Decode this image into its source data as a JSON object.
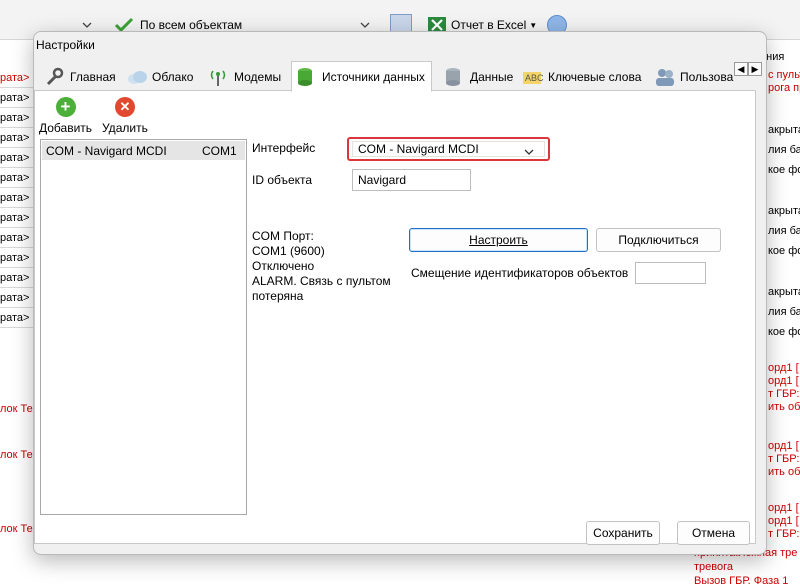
{
  "background": {
    "toolbar": {
      "filter_label": "По всем объектам",
      "export_label": "Отчет в Excel"
    },
    "right_header": "ения",
    "left_rows": [
      {
        "text": "рата>",
        "color": "red"
      },
      {
        "text": "рата>",
        "color": "dark"
      },
      {
        "text": "рата>",
        "color": "dark"
      },
      {
        "text": "рата>",
        "color": "dark"
      },
      {
        "text": "рата>",
        "color": "dark"
      },
      {
        "text": "рата>",
        "color": "dark"
      },
      {
        "text": "рата>",
        "color": "dark"
      },
      {
        "text": "рата>",
        "color": "dark"
      },
      {
        "text": "рата>",
        "color": "dark"
      },
      {
        "text": "рата>",
        "color": "dark"
      },
      {
        "text": "рата>",
        "color": "dark"
      },
      {
        "text": "рата>",
        "color": "dark"
      },
      {
        "text": "рата>",
        "color": "dark"
      }
    ],
    "left_extra": [
      "лок Тех",
      "лок Тех",
      "лок Тех"
    ],
    "right_texts": [
      "с пульт",
      "рога при",
      "акрыта",
      "лия ба",
      "кое фо",
      "акрыта",
      "лия ба",
      "кое фо",
      "акрыта",
      "лия ба",
      "кое фо",
      "орд1 [",
      "орд1 [",
      "т ГБР:",
      "ить обр",
      "орд1 [",
      "т ГБР:",
      "ить обр",
      "орд1 [",
      "орд1 [",
      "т ГБР:"
    ],
    "bottom_text": [
      "принята.Ложная тре",
      "тревога",
      "Вызов ГБР. Фаза 1"
    ]
  },
  "dialog": {
    "title": "Настройки",
    "tabs": [
      {
        "label": "Главная",
        "icon": "wrench-icon"
      },
      {
        "label": "Облако",
        "icon": "cloud-icon"
      },
      {
        "label": "Модемы",
        "icon": "antenna-icon"
      },
      {
        "label": "Источники данных",
        "icon": "database-green-icon",
        "active": true
      },
      {
        "label": "Данные",
        "icon": "database-icon"
      },
      {
        "label": "Ключевые слова",
        "icon": "keywords-icon"
      },
      {
        "label": "Пользова",
        "icon": "users-icon"
      }
    ],
    "toolbar": {
      "add_label": "Добавить",
      "delete_label": "Удалить"
    },
    "sources": [
      {
        "name": "COM - Navigard MCDI",
        "port": "COM1"
      }
    ],
    "form": {
      "interface_label": "Интерфейс",
      "interface_value": "COM - Navigard MCDI",
      "object_id_label": "ID объекта",
      "object_id_value": "Navigard",
      "configure_button": "Настроить",
      "connect_button": "Подключиться",
      "offset_label": "Смещение идентификаторов объектов",
      "offset_value": "",
      "status_lines": [
        "COM Порт:",
        "COM1 (9600)",
        "Отключено",
        "ALARM. Связь с пультом потеряна"
      ]
    },
    "footer": {
      "save_button": "Сохранить",
      "cancel_button": "Отмена"
    },
    "colors": {
      "interface_highlight": "#d9373b",
      "add_icon": "#4caf3a",
      "delete_icon": "#e0492f"
    }
  }
}
